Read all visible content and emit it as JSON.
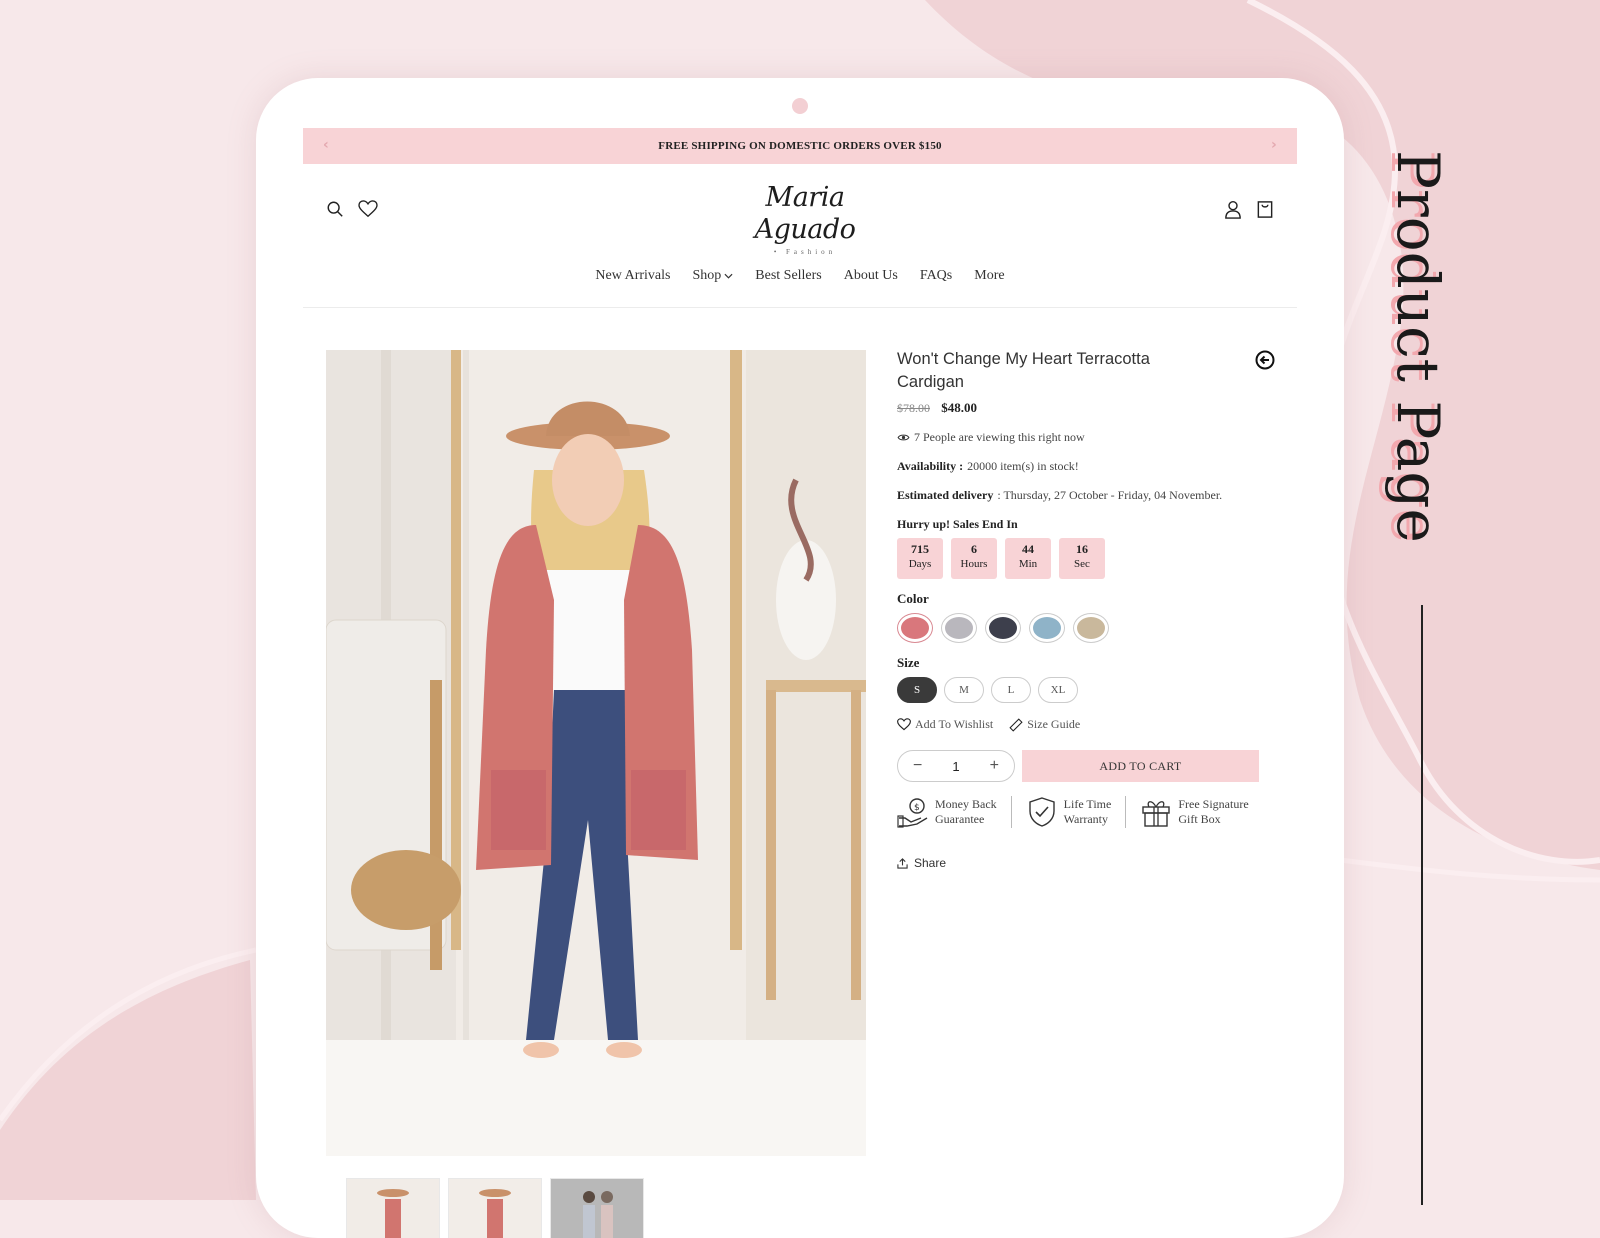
{
  "side_title": "Product Page",
  "announcement": {
    "text": "FREE SHIPPING ON DOMESTIC ORDERS OVER $150",
    "prev": "‹",
    "next": "›"
  },
  "logo": {
    "script": "Maria Aguado",
    "sub": "• Fashion"
  },
  "nav": {
    "items": [
      "New Arrivals",
      "Shop",
      "Best Sellers",
      "About Us",
      "FAQs",
      "More"
    ]
  },
  "product": {
    "title": "Won't Change My Heart Terracotta Cardigan",
    "old_price": "$78.00",
    "price": "$48.00",
    "viewers": "7 People are viewing this right now",
    "availability_label": "Availability :",
    "availability_value": "20000 item(s) in stock!",
    "delivery_label": "Estimated delivery",
    "delivery_value": ": Thursday, 27 October - Friday, 04 November.",
    "hurry_label": "Hurry up! Sales End In",
    "countdown": [
      {
        "value": "715",
        "unit": "Days"
      },
      {
        "value": "6",
        "unit": "Hours"
      },
      {
        "value": "44",
        "unit": "Min"
      },
      {
        "value": "16",
        "unit": "Sec"
      }
    ],
    "color_label": "Color",
    "colors": [
      "#d9777c",
      "#b9b7bd",
      "#3d3f4c",
      "#8fb3c8",
      "#c9b89c"
    ],
    "size_label": "Size",
    "sizes": [
      "S",
      "M",
      "L",
      "XL"
    ],
    "selected_size": "S",
    "wishlist_label": "Add To Wishlist",
    "size_guide_label": "Size Guide",
    "quantity": "1",
    "qty_minus": "−",
    "qty_plus": "+",
    "add_to_cart": "ADD TO CART",
    "perks": [
      {
        "line1": "Money Back",
        "line2": "Guarantee"
      },
      {
        "line1": "Life Time",
        "line2": "Warranty"
      },
      {
        "line1": "Free Signature",
        "line2": "Gift Box"
      }
    ],
    "share_label": "Share"
  },
  "colors": {
    "accent_pink": "#f8d3d6",
    "background": "#f7e8ea",
    "dark": "#3a3a3a"
  }
}
